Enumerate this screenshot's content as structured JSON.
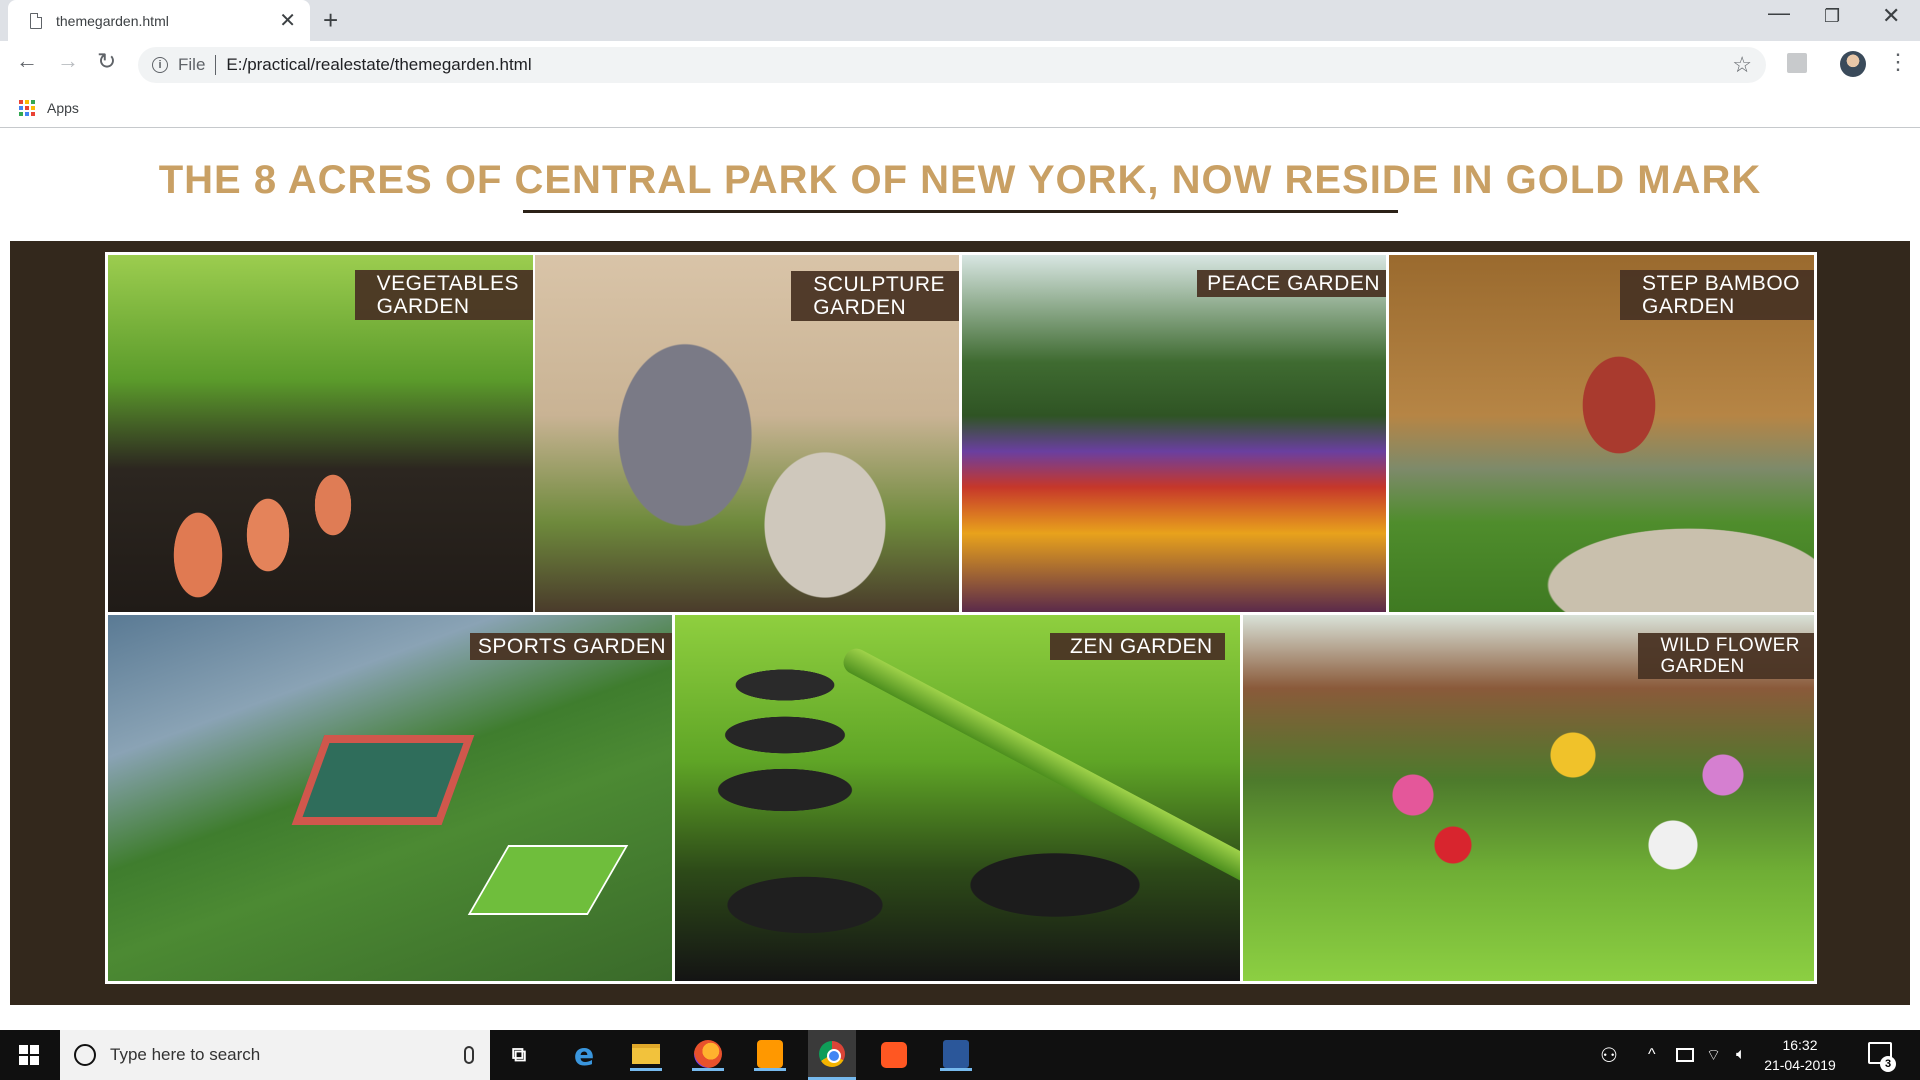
{
  "browser": {
    "tab_title": "themegarden.html",
    "tab_close": "✕",
    "new_tab": "+",
    "window_minimize": "—",
    "window_maximize": "❐",
    "window_close": "✕",
    "nav_back": "←",
    "nav_forward": "→",
    "nav_reload": "↻",
    "info_icon": "i",
    "url_scheme": "File",
    "url": "E:/practical/realestate/themegarden.html",
    "star": "☆",
    "menu": "⋮",
    "bookmarks_apps": "Apps",
    "apps_colors": [
      "#ea4335",
      "#fbbc05",
      "#34a853",
      "#4285f4",
      "#ea4335",
      "#fbbc05",
      "#34a853",
      "#4285f4",
      "#ea4335"
    ]
  },
  "page": {
    "headline": "THE 8 ACRES OF CENTRAL PARK OF NEW YORK, NOW RESIDE IN GOLD MARK",
    "accent_color": "#c9a064",
    "panel_color": "#33281c",
    "gardens": [
      {
        "label": "VEGETABLES\nGARDEN"
      },
      {
        "label": "SCULPTURE\nGARDEN"
      },
      {
        "label": "PEACE GARDEN"
      },
      {
        "label": "STEP BAMBOO\nGARDEN"
      },
      {
        "label": "SPORTS GARDEN"
      },
      {
        "label": "ZEN GARDEN"
      },
      {
        "label": "WILD FLOWER\nGARDEN"
      }
    ]
  },
  "taskbar": {
    "search_placeholder": "Type here to search",
    "time": "16:32",
    "date": "21-04-2019",
    "notification_count": "3",
    "edge_glyph": "e",
    "taskview_glyph": "⧉",
    "people_glyph": "⚇",
    "up_glyph": "^",
    "volume_glyph": "🔈︎",
    "wifi_glyph": "⌔"
  }
}
